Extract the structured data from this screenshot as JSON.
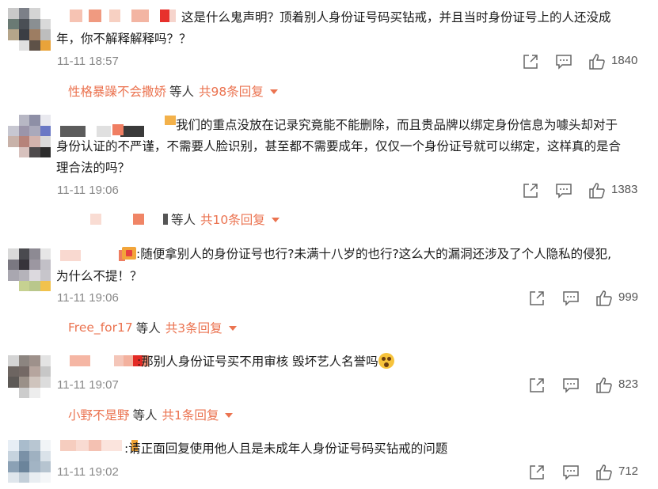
{
  "comments": [
    {
      "text_lines": [
        "这是什么鬼声明？顶着别人身份证号码买钻戒，并且当时身份证号上的人还没成",
        "年，你不解释解释吗？？"
      ],
      "time": "11-11 18:57",
      "likes": "1840",
      "reply": {
        "who": "性格暴躁不会撒娇",
        "mid": "等人",
        "count": "共98条回复"
      }
    },
    {
      "text_lines": [
        "我们的重点没放在记录究竟能不能删除，而且贵品牌以绑定身份信息为噱头却对于",
        "身份认证的不严谨，不需要人脸识别，甚至都不需要成年，仅仅一个身份证号就可以绑定，这样真的是合",
        "理合法的吗？"
      ],
      "time": "11-11 19:06",
      "likes": "1383",
      "reply": {
        "who": "",
        "mid": "等人",
        "count": "共10条回复"
      }
    },
    {
      "text_lines": [
        ":随便拿别人的身份证号也行?未满十八岁的也行?这么大的漏洞还涉及了个人隐私的侵犯,",
        "为什么不提！？"
      ],
      "time": "11-11 19:06",
      "likes": "999",
      "reply": {
        "who": "Free_for17",
        "mid": "等人",
        "count": "共3条回复"
      }
    },
    {
      "text_lines": [
        ":那别人身份证号买不用审核 毁坏艺人名誉吗"
      ],
      "time": "11-11 19:07",
      "likes": "823",
      "reply": {
        "who": "小野不是野",
        "mid": "等人",
        "count": "共1条回复"
      }
    },
    {
      "text_lines": [
        ":请正面回复使用他人且是未成年人身份证号码买钻戒的问题"
      ],
      "time": "11-11 19:02",
      "likes": "712"
    }
  ],
  "icons": {
    "share": "share-icon",
    "comment": "comment-icon",
    "like": "thumbs-up-icon",
    "caret": "caret-down-icon"
  },
  "colors": {
    "accent": "#eb7350",
    "muted": "#888888"
  }
}
